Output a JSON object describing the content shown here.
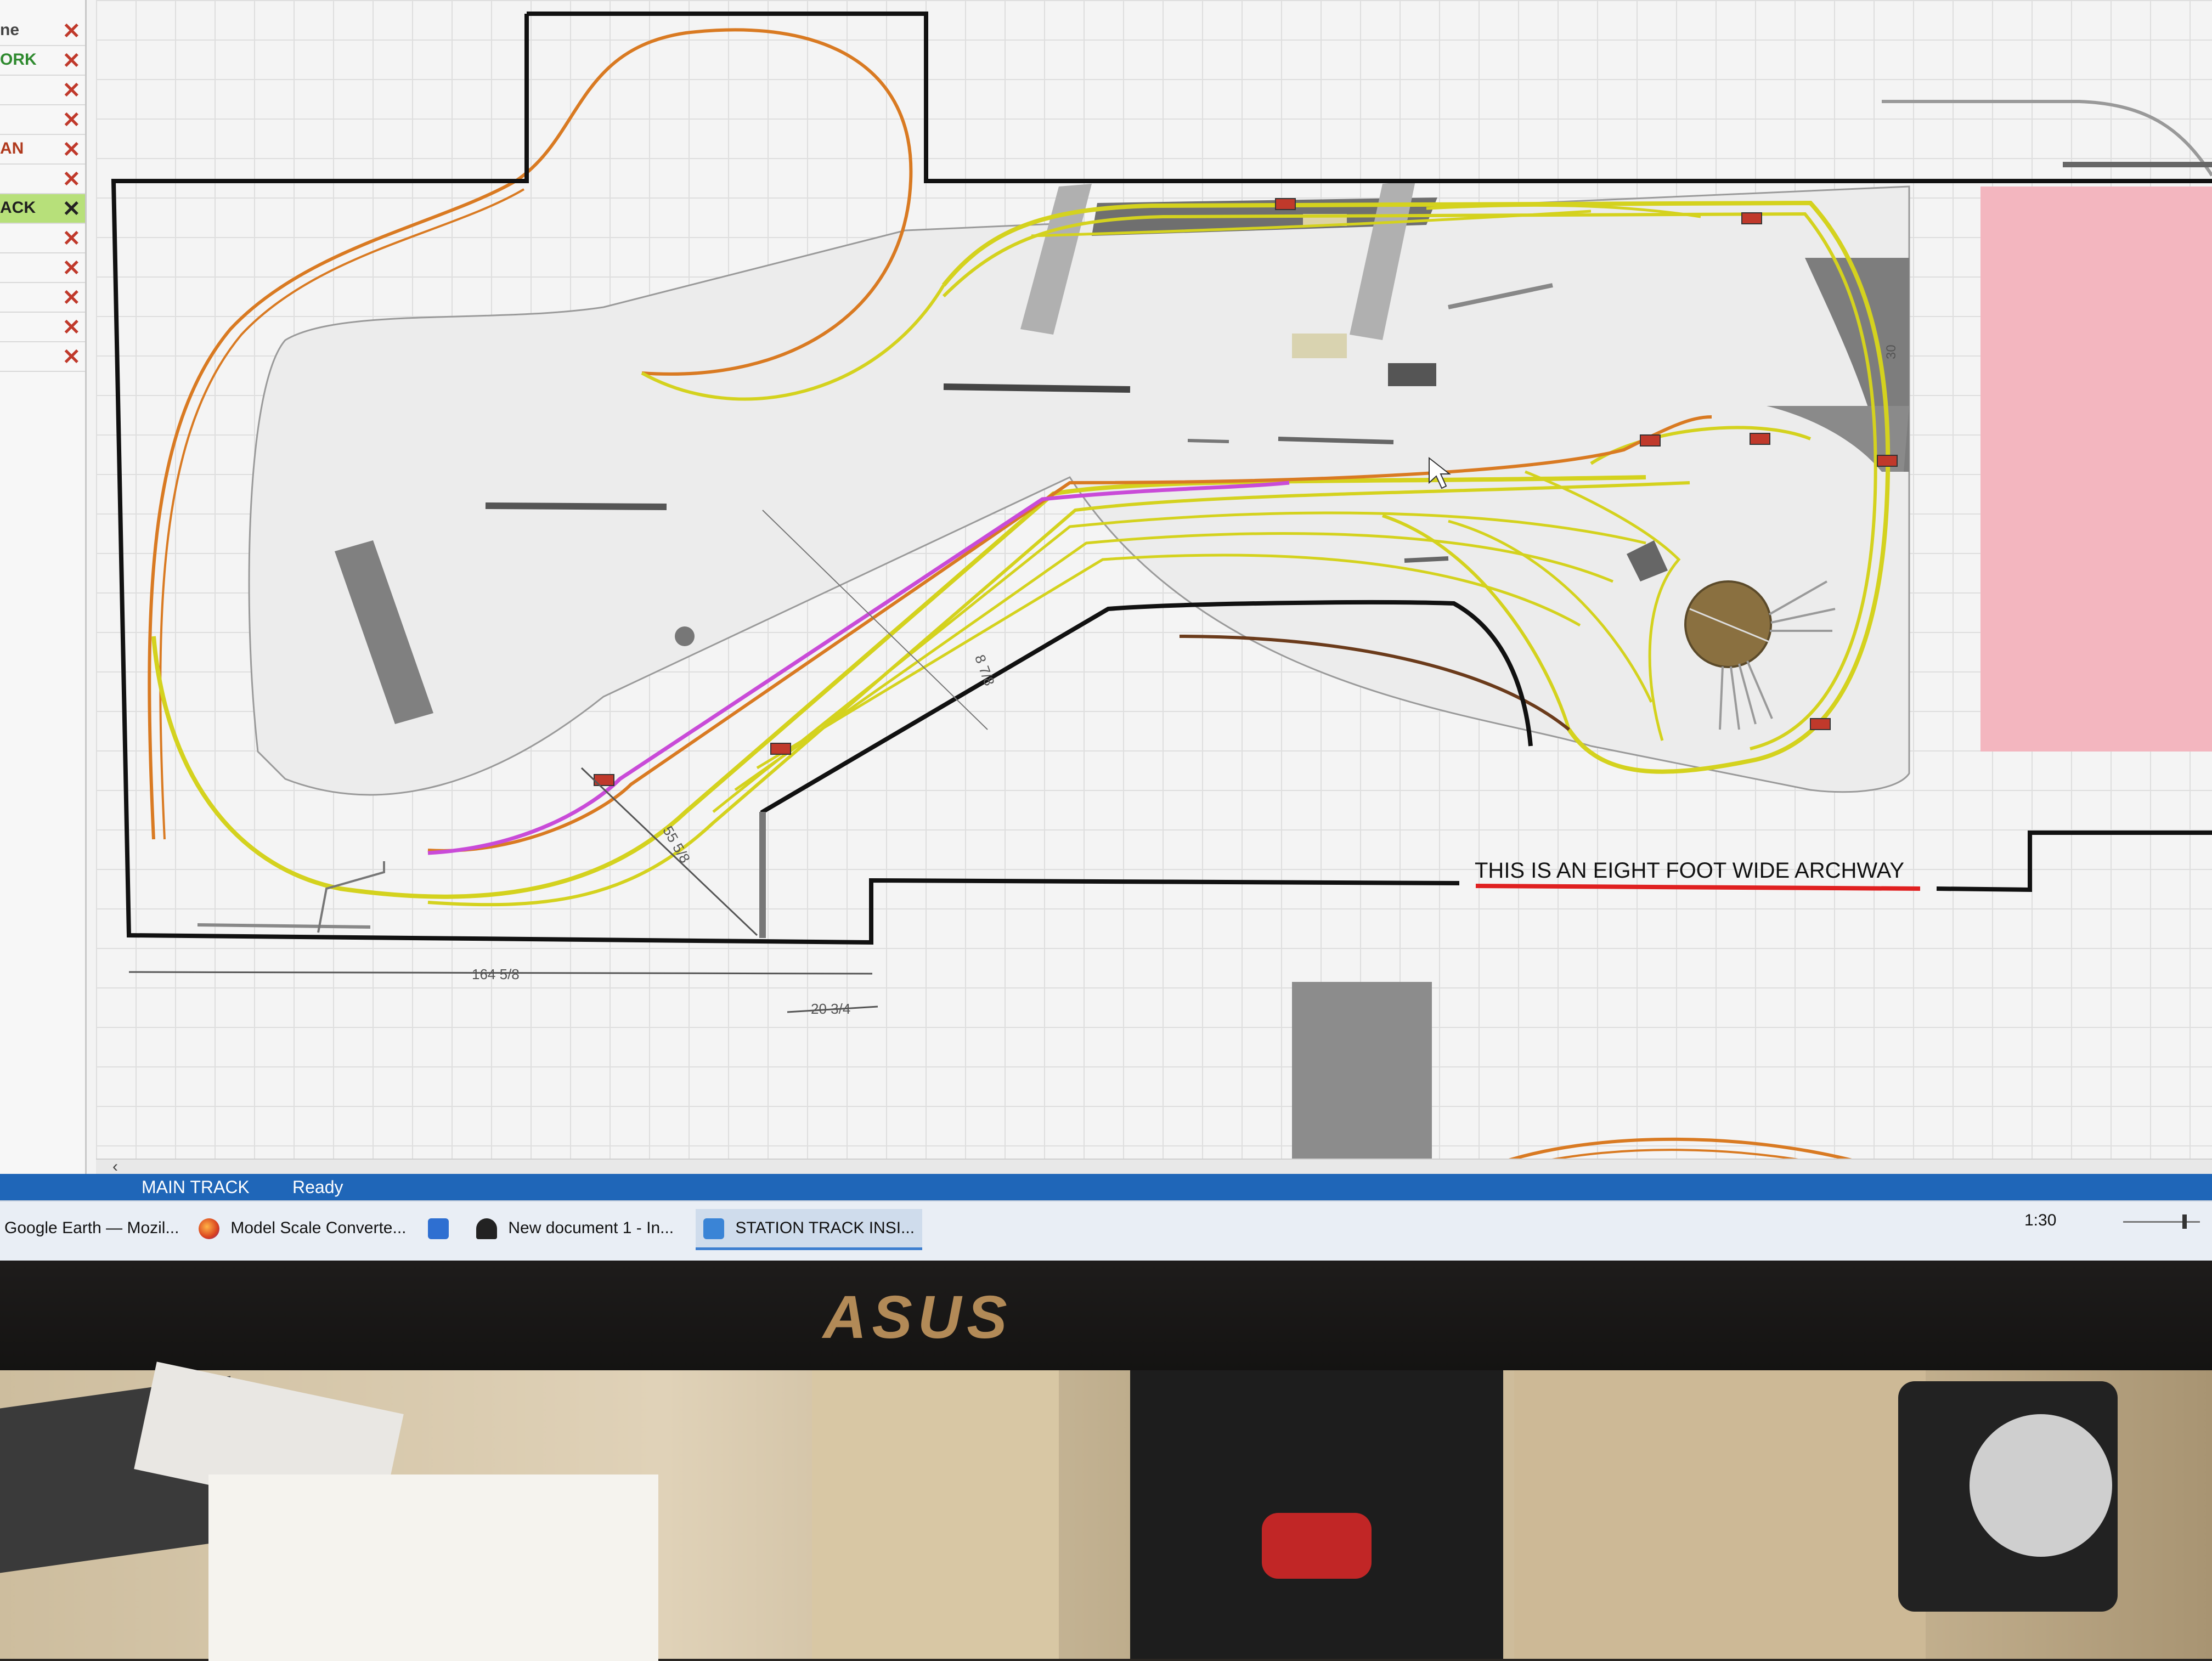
{
  "layer_panel": {
    "items": [
      {
        "label": "ne",
        "color": "#444444",
        "active": false
      },
      {
        "label": "ORK",
        "color": "#2f8a2f",
        "active": false
      },
      {
        "label": "",
        "color": "#444444",
        "active": false
      },
      {
        "label": "",
        "color": "#444444",
        "active": false
      },
      {
        "label": "AN",
        "color": "#b03a1e",
        "active": false
      },
      {
        "label": "",
        "color": "#444444",
        "active": false
      },
      {
        "label": "ACK",
        "color": "#1f1f1f",
        "active": true
      },
      {
        "label": "",
        "color": "#444444",
        "active": false
      },
      {
        "label": "",
        "color": "#444444",
        "active": false
      },
      {
        "label": "",
        "color": "#444444",
        "active": false
      },
      {
        "label": "",
        "color": "#444444",
        "active": false
      },
      {
        "label": "",
        "color": "#444444",
        "active": false
      }
    ],
    "delete_glyph": "✕"
  },
  "canvas": {
    "dimensions": {
      "width_label": "164 5/8",
      "offset_label": "20 3/4",
      "diagonal_label": "55 5/8",
      "inner_label": "8 7/8",
      "right_label": "30"
    },
    "archway_note": "THIS IS AN EIGHT FOOT WIDE ARCHWAY",
    "colors": {
      "main_track": "#d4d21e",
      "upper_track": "#d97a22",
      "highlight_track": "#c94bd8",
      "wall": "#111111",
      "archway_line": "#e02020",
      "room_pink": "#f3b6bf",
      "turntable": "#8a7040"
    }
  },
  "scroll": {
    "left_arrow": "‹"
  },
  "status_bar": {
    "layer": "MAIN TRACK",
    "state": "Ready"
  },
  "taskbar": {
    "items": [
      {
        "label": "Google Earth — Mozil...",
        "icon": "google-earth-icon"
      },
      {
        "label": "Model Scale Converte...",
        "icon": "firefox-icon"
      },
      {
        "label": "",
        "icon": "mail-icon"
      },
      {
        "label": "New document 1 - In...",
        "icon": "inkscape-icon"
      },
      {
        "label": "STATION TRACK INSI...",
        "icon": "track-planner-icon"
      }
    ],
    "clock": "1:30"
  },
  "monitor": {
    "brand": "ASUS"
  }
}
